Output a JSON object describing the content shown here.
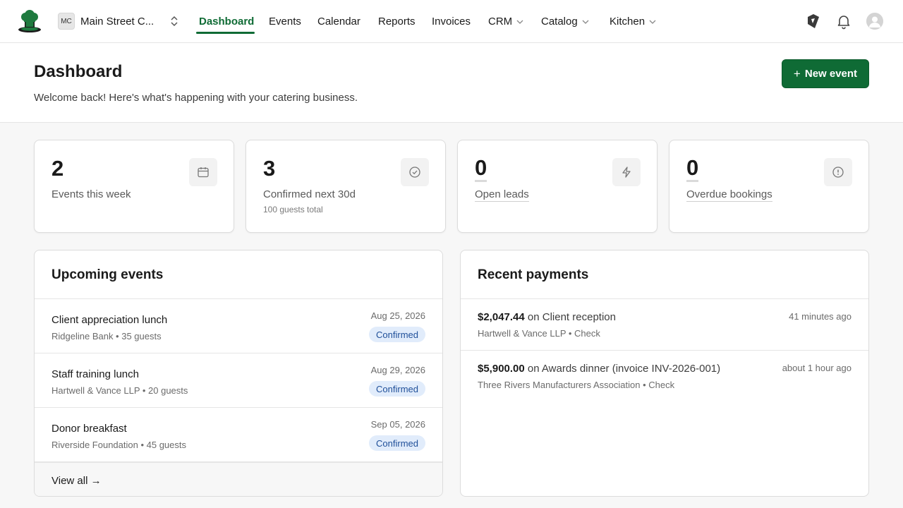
{
  "topnav": {
    "org_initials": "MC",
    "org_name": "Main Street C...",
    "items": [
      {
        "label": "Dashboard",
        "active": true
      },
      {
        "label": "Events"
      },
      {
        "label": "Calendar"
      },
      {
        "label": "Reports"
      },
      {
        "label": "Invoices"
      },
      {
        "label": "CRM",
        "dropdown": true
      },
      {
        "label": "Catalog",
        "dropdown": true
      },
      {
        "label": "Kitchen",
        "dropdown": true
      }
    ],
    "icons": [
      "chef-hat-logo-icon",
      "unfold-icon",
      "feature-tag-icon",
      "bell-icon",
      "avatar"
    ]
  },
  "header": {
    "title": "Dashboard",
    "subtitle": "Welcome back! Here's what's happening with your catering business.",
    "new_event_label": "New event"
  },
  "stats": [
    {
      "value": "2",
      "label": "Events this week",
      "icon": "calendar-icon"
    },
    {
      "value": "3",
      "label": "Confirmed next 30d",
      "note": "100 guests total",
      "icon": "check-circle-icon"
    },
    {
      "value": "0",
      "label": "Open leads",
      "icon": "lightning-icon"
    },
    {
      "value": "0",
      "label": "Overdue bookings",
      "icon": "alert-circle-icon"
    }
  ],
  "upcoming": {
    "title": "Upcoming events",
    "events": [
      {
        "name": "Client appreciation lunch",
        "meta": "Ridgeline Bank • 35 guests",
        "date": "Aug 25, 2026",
        "status": "Confirmed"
      },
      {
        "name": "Staff training lunch",
        "meta": "Hartwell & Vance LLP • 20 guests",
        "date": "Aug 29, 2026",
        "status": "Confirmed"
      },
      {
        "name": "Donor breakfast",
        "meta": "Riverside Foundation • 45 guests",
        "date": "Sep 05, 2026",
        "status": "Confirmed"
      }
    ],
    "view_all": "View all →"
  },
  "payments": {
    "title": "Recent payments",
    "items": [
      {
        "amount": "$2,047.44",
        "desc": " on Client reception",
        "meta": "Hartwell & Vance LLP • Check",
        "time": "41 minutes ago"
      },
      {
        "amount": "$5,900.00",
        "desc": " on Awards dinner (invoice INV-2026-001)",
        "meta": "Three Rivers Manufacturers Association • Check",
        "time": "about 1 hour ago"
      }
    ]
  },
  "colors": {
    "brand": "#0f6b35",
    "badge_bg": "#e1ecfb",
    "badge_text": "#1f4f99"
  }
}
